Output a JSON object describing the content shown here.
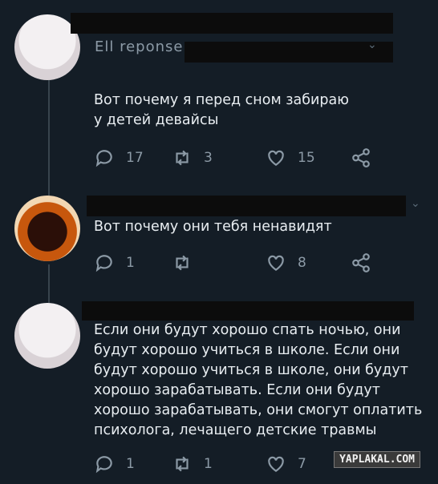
{
  "tweets": [
    {
      "handle_visible": "Ell reponse",
      "text": "Вот почему я перед сном забираю\nу детей девайсы",
      "reply_count": "17",
      "retweet_count": "3",
      "like_count": "15"
    },
    {
      "text": "Вот почему они тебя ненавидят",
      "reply_count": "1",
      "retweet_count": "",
      "like_count": "8"
    },
    {
      "text": "Если они будут хорошо спать ночью, они\nбудут хорошо учиться в школе. Если они\nбудут хорошо учиться в школе, они будут\nхорошо зарабатывать. Если они будут\nхорошо зарабатывать, они смогут оплатить\nпсихолога, лечащего детские травмы",
      "reply_count": "1",
      "retweet_count": "1",
      "like_count": "7"
    }
  ],
  "watermark": "YAPLAKAL.COM",
  "colors": {
    "background": "#141d26",
    "text": "#e7ecf0",
    "muted": "#8c9aa6"
  }
}
